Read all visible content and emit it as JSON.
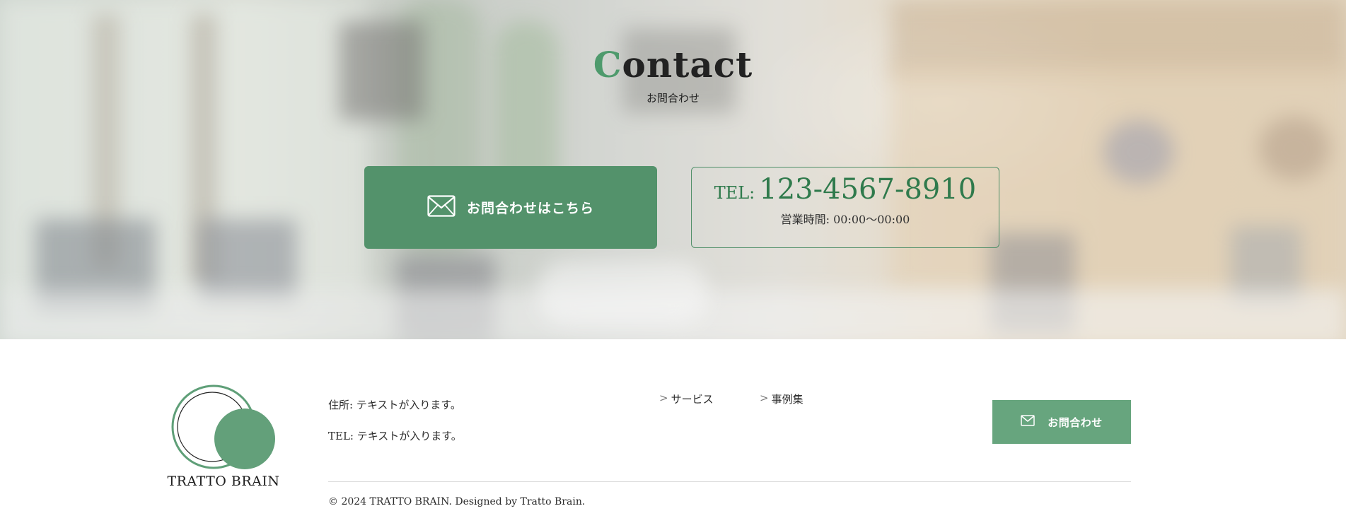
{
  "contact": {
    "title_first": "C",
    "title_rest": "ontact",
    "subtitle": "お問合わせ",
    "cta_label": "お問合わせはこちら",
    "tel_prefix": "TEL:",
    "tel_number": "123-4567-8910",
    "hours": "営業時間: 00:00〜00:00"
  },
  "footer": {
    "logo_text": "TRATTO BRAIN",
    "address": "住所: テキストが入ります。",
    "tel": "TEL: テキストが入ります。",
    "nav": [
      {
        "arrow": ">",
        "label": "サービス"
      },
      {
        "arrow": ">",
        "label": "事例集"
      }
    ],
    "contact_button": "お問合わせ",
    "copyright": "© 2024 TRATTO BRAIN. Designed by Tratto Brain."
  },
  "colors": {
    "brand_green": "#53926b",
    "footer_button_green": "#67a57e",
    "tel_text_green": "#2f7a4c"
  },
  "icons": {
    "cta": "mail-icon",
    "footer_button": "mail-icon"
  }
}
